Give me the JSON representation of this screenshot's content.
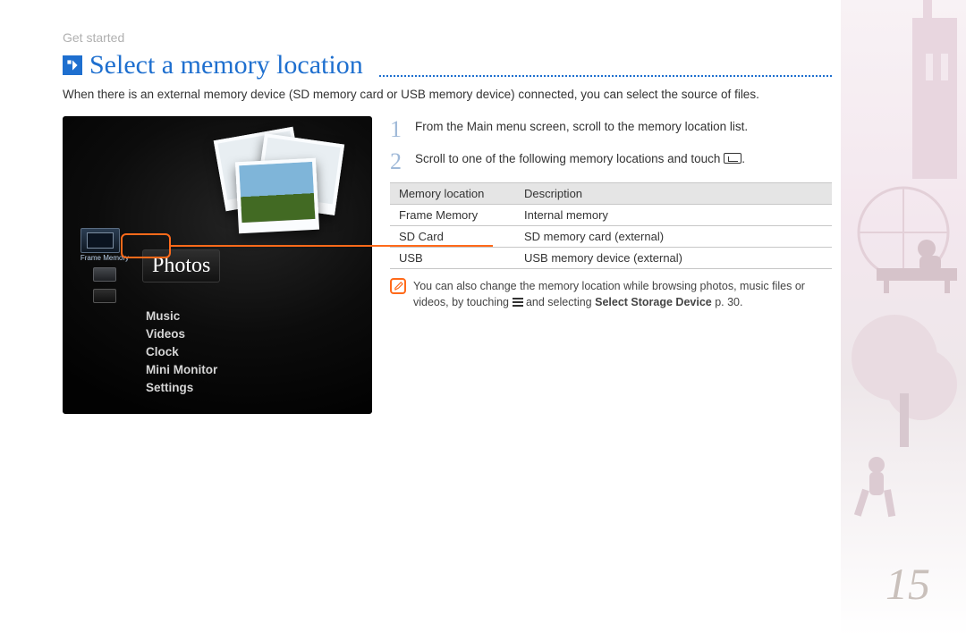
{
  "breadcrumb": "Get started",
  "title": "Select a memory location",
  "intro": "When there is an external memory device (SD memory card or USB memory device) connected, you can select the source of files.",
  "device": {
    "memory_label": "Frame Memory",
    "active_item": "Photos",
    "menu": [
      "Music",
      "Videos",
      "Clock",
      "Mini Monitor",
      "Settings"
    ]
  },
  "steps": [
    {
      "num": "1",
      "text": "From the Main menu screen, scroll to the memory location list."
    },
    {
      "num": "2",
      "text_pre": "Scroll to one of the following memory locations and touch ",
      "text_post": "."
    }
  ],
  "table": {
    "headers": [
      "Memory location",
      "Description"
    ],
    "rows": [
      [
        "Frame Memory",
        "Internal memory"
      ],
      [
        "SD Card",
        "SD memory card (external)"
      ],
      [
        "USB",
        "USB memory device (external)"
      ]
    ]
  },
  "note": {
    "pre": "You can also change the memory location while browsing photos, music files or videos, by touching ",
    "mid": " and selecting ",
    "bold": "Select Storage Device",
    "post": " p. 30."
  },
  "page_number": "15"
}
